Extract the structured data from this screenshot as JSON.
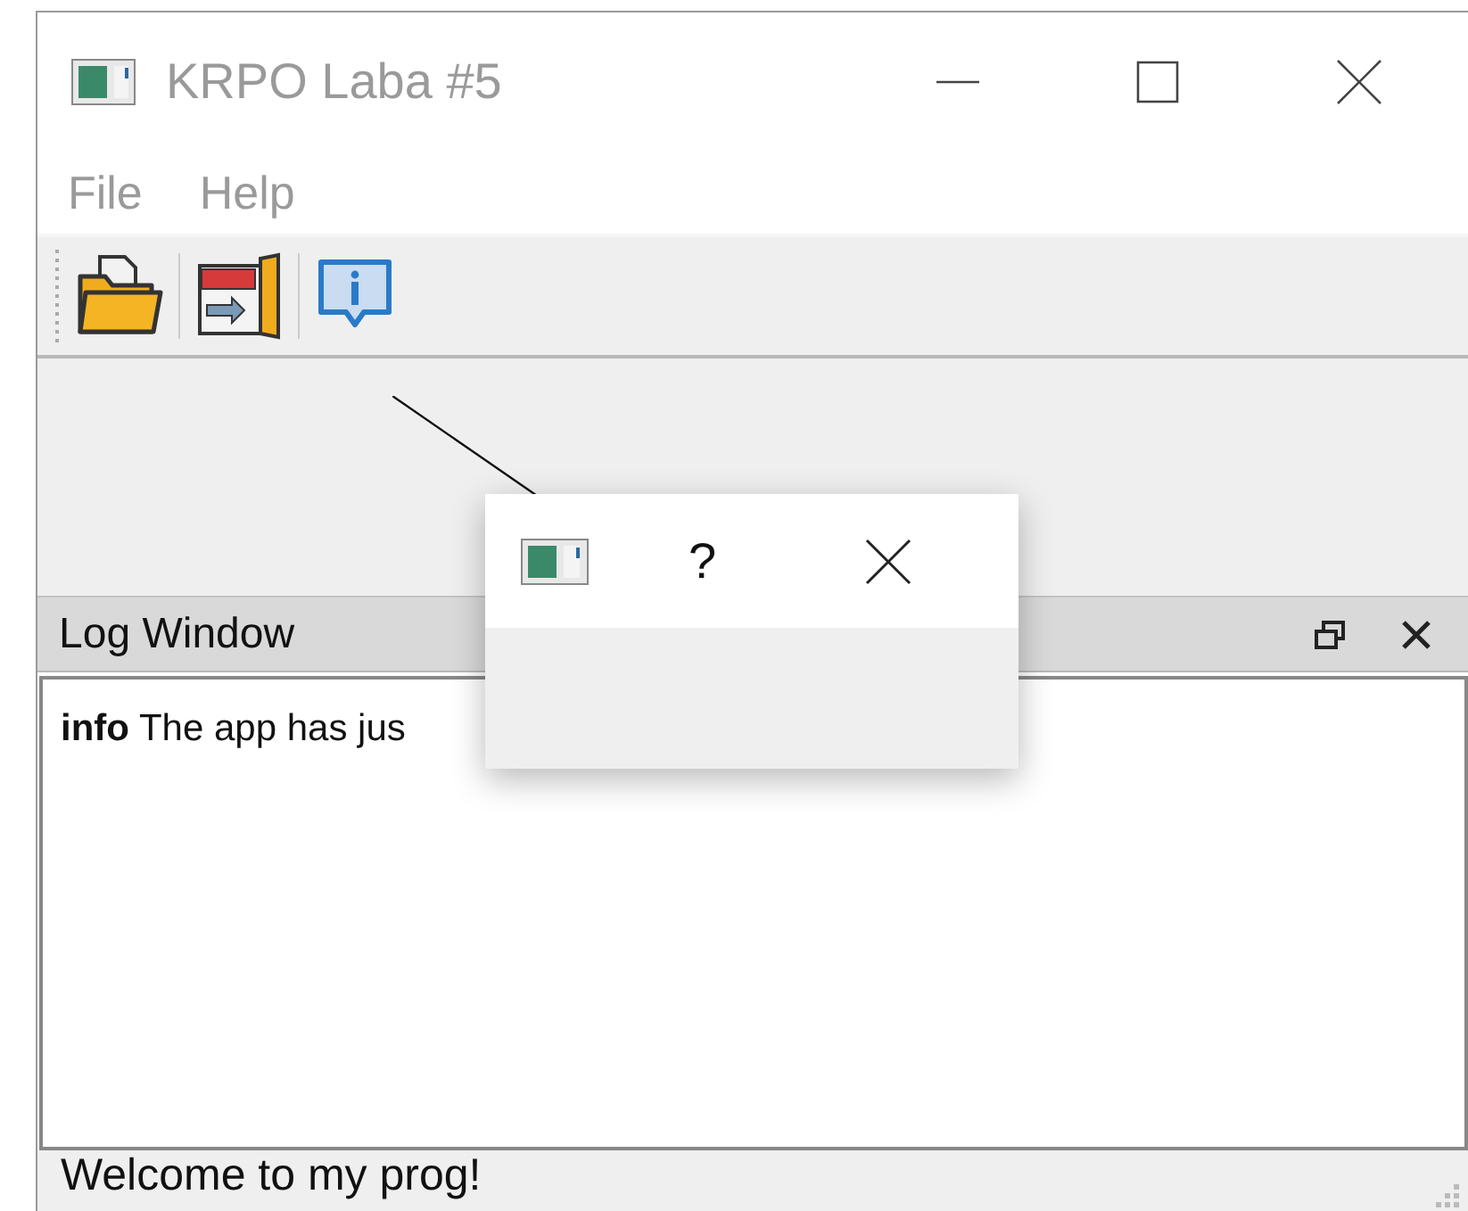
{
  "window": {
    "title": "KRPO Laba #5",
    "active": false
  },
  "menu": [
    {
      "label": "File"
    },
    {
      "label": "Help"
    }
  ],
  "toolbar": [
    {
      "kind": "open"
    },
    {
      "kind": "exit"
    },
    {
      "kind": "info"
    }
  ],
  "log_window": {
    "title": "Log Window",
    "entries": [
      {
        "text": "**info** The app has jus"
      }
    ]
  },
  "dialog": {
    "help": "?"
  },
  "status_bar": {
    "text": "Welcome to my prog!"
  }
}
